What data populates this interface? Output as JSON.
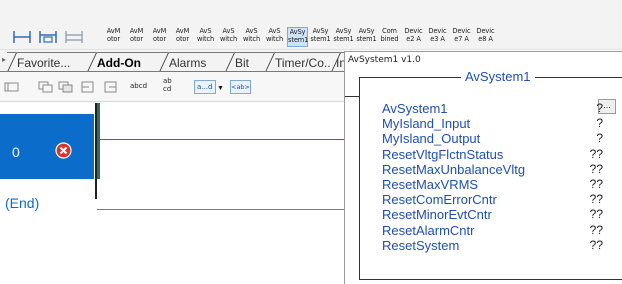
{
  "toolbar": {
    "instructions": [
      {
        "label": "AvM\notor"
      },
      {
        "label": "AvM\notor"
      },
      {
        "label": "AvM\notor"
      },
      {
        "label": "AvM\notor"
      },
      {
        "label": "AvS\nwitch"
      },
      {
        "label": "AvS\nwitch"
      },
      {
        "label": "AvS\nwitch"
      },
      {
        "label": "AvS\nwitch"
      },
      {
        "label": "AvSy\nstem1"
      },
      {
        "label": "AvSy\nstem1"
      },
      {
        "label": "AvSy\nstem1"
      },
      {
        "label": "AvSy\nstem1"
      },
      {
        "label": "Com\nbined"
      },
      {
        "label": "Devic\ne2 A"
      },
      {
        "label": "Devic\ne3 A"
      },
      {
        "label": "Devic\ne7 A"
      },
      {
        "label": "Devic\ne8 A"
      }
    ],
    "ladder_icons": [
      "rung-icon",
      "branch-icon",
      "branch-level-icon"
    ]
  },
  "tabs": [
    {
      "label": "Favorite..."
    },
    {
      "label": "Add-On"
    },
    {
      "label": "Alarms"
    },
    {
      "label": "Bit"
    },
    {
      "label": "Timer/Co..."
    },
    {
      "label": "Inpu"
    }
  ],
  "toolbar2": {
    "text_abcd": "abcd",
    "text_ab_cd": "ab\ncd",
    "combo_value": "a...d",
    "tag_button": "<ab>"
  },
  "ladder": {
    "rung_number": "0",
    "end_label": "(End)",
    "colors": {
      "rung_band": "#0b6cc9",
      "error": "#d9342b",
      "wire": "#c0392b"
    }
  },
  "popup": {
    "title": "AvSystem1 v1.0",
    "header": "AvSystem1",
    "ellipsis_button": "...",
    "params": [
      {
        "name": "AvSystem1",
        "value": "?"
      },
      {
        "name": "MyIsland_Input",
        "value": "?"
      },
      {
        "name": "MyIsland_Output",
        "value": "?"
      },
      {
        "name": "ResetVltgFlctnStatus",
        "value": "??"
      },
      {
        "name": "ResetMaxUnbalanceVltg",
        "value": "??"
      },
      {
        "name": "ResetMaxVRMS",
        "value": "??"
      },
      {
        "name": "ResetComErrorCntr",
        "value": "??"
      },
      {
        "name": "ResetMinorEvtCntr",
        "value": "??"
      },
      {
        "name": "ResetAlarmCntr",
        "value": "??"
      },
      {
        "name": "ResetSystem",
        "value": "??"
      }
    ]
  }
}
